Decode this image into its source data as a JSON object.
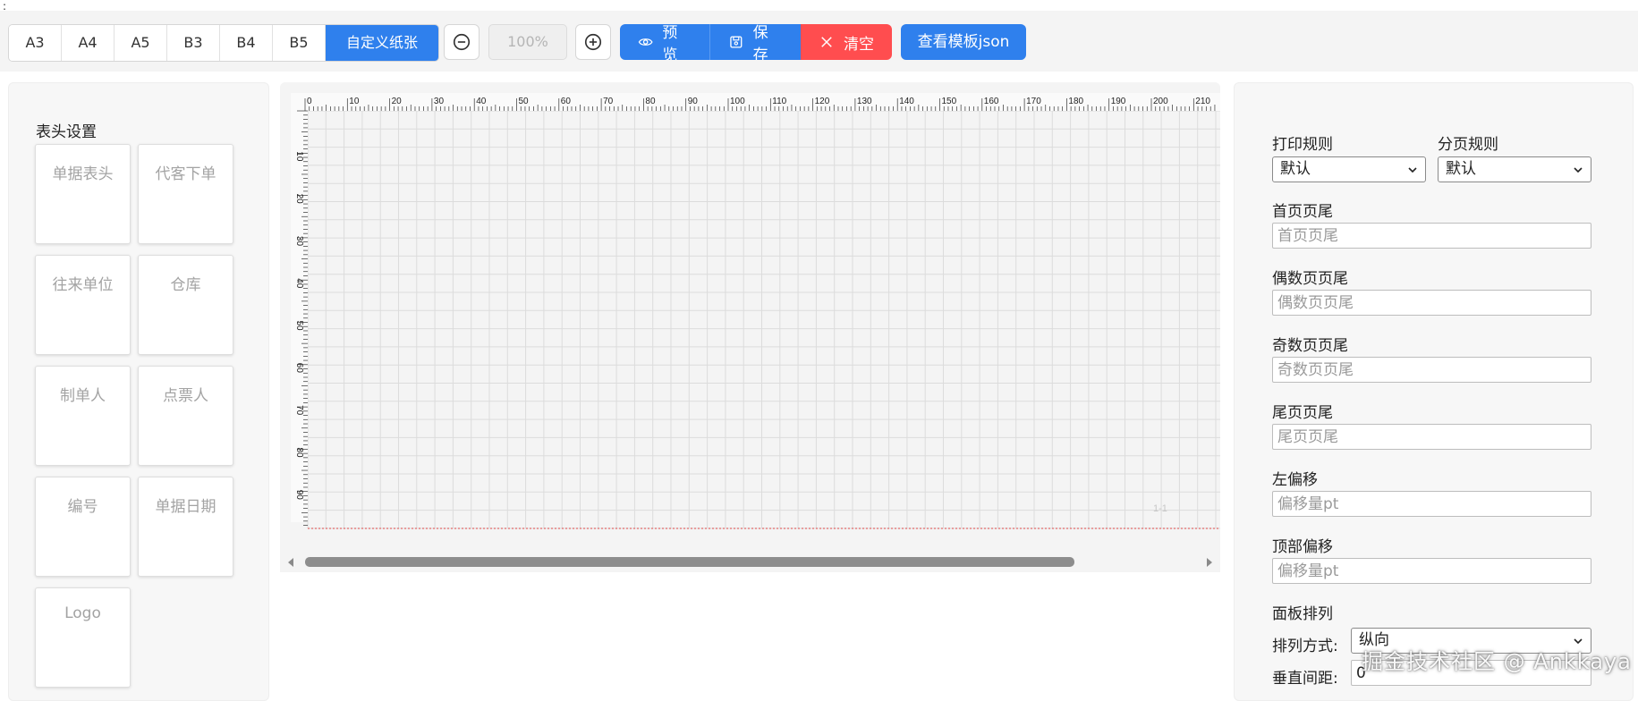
{
  "toolbar": {
    "paper_sizes": [
      "A3",
      "A4",
      "A5",
      "B3",
      "B4",
      "B5"
    ],
    "custom_paper_label": "自定义纸张",
    "zoom_value": "100%",
    "preview_label": "预览",
    "save_label": "保存",
    "clear_label": "清空",
    "view_json_label": "查看模板json",
    "accent_color": "#2f80ed",
    "danger_color": "#ff4d4f"
  },
  "left_panel": {
    "section_title": "表头设置",
    "items": [
      "单据表头",
      "代客下单",
      "往来单位",
      "仓库",
      "制单人",
      "点票人",
      "编号",
      "单据日期",
      "Logo"
    ]
  },
  "canvas": {
    "ruler_labels": [
      "0",
      "10",
      "20",
      "30",
      "40",
      "50",
      "60",
      "70",
      "80",
      "90",
      "100",
      "110",
      "120",
      "130",
      "140",
      "150",
      "160",
      "170",
      "180",
      "190",
      "200",
      "210"
    ],
    "vertical_ruler_labels": [
      "10",
      "20",
      "30",
      "40",
      "50",
      "60",
      "70",
      "80",
      "90",
      "00"
    ],
    "page_number": "1-1"
  },
  "right_panel": {
    "print_rule_label": "打印规则",
    "print_rule_value": "默认",
    "page_rule_label": "分页规则",
    "page_rule_value": "默认",
    "first_footer_label": "首页页尾",
    "first_footer_placeholder": "首页页尾",
    "even_footer_label": "偶数页页尾",
    "even_footer_placeholder": "偶数页页尾",
    "odd_footer_label": "奇数页页尾",
    "odd_footer_placeholder": "奇数页页尾",
    "last_footer_label": "尾页页尾",
    "last_footer_placeholder": "尾页页尾",
    "left_offset_label": "左偏移",
    "left_offset_placeholder": "偏移量pt",
    "top_offset_label": "顶部偏移",
    "top_offset_placeholder": "偏移量pt",
    "panel_layout_label": "面板排列",
    "layout_mode_label": "排列方式:",
    "layout_mode_value": "纵向",
    "vertical_gap_label": "垂直间距:",
    "vertical_gap_value": "0"
  },
  "watermark": "掘金技术社区 @ Ankkaya"
}
